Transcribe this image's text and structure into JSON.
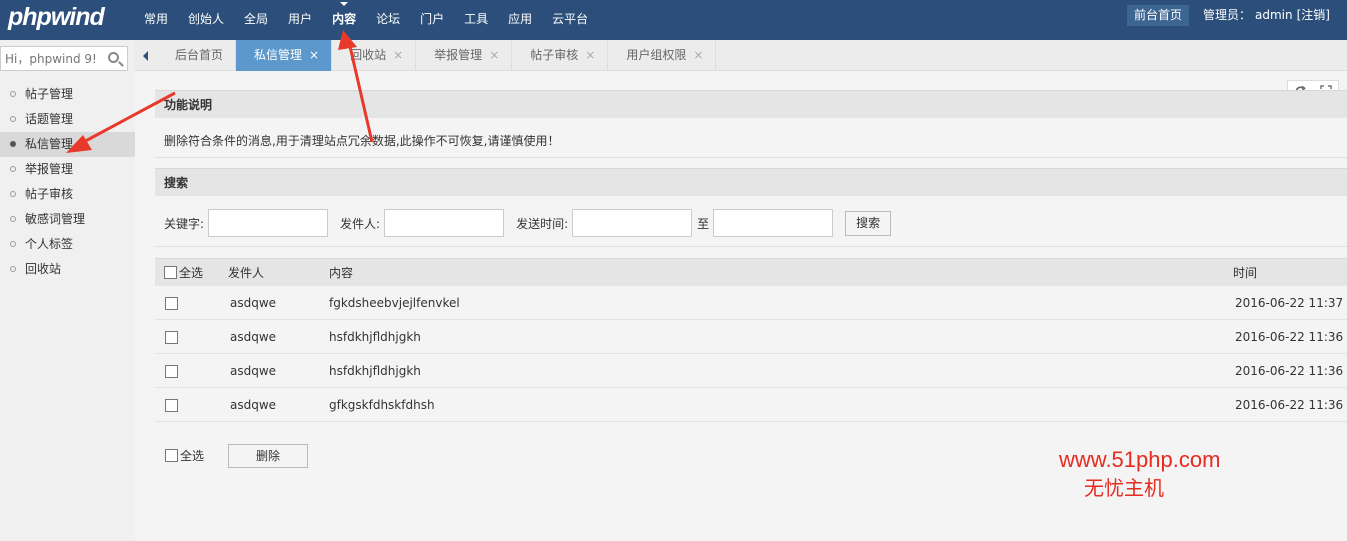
{
  "header": {
    "logo": "phpwind",
    "nav": [
      "常用",
      "创始人",
      "全局",
      "用户",
      "内容",
      "论坛",
      "门户",
      "工具",
      "应用",
      "云平台"
    ],
    "active_nav": "内容",
    "front_home": "前台首页",
    "admin_label": "管理员：",
    "admin_name": "admin",
    "logout": "[注销]"
  },
  "sidebar": {
    "search_placeholder": "Hi，phpwind 9!",
    "items": [
      "帖子管理",
      "话题管理",
      "私信管理",
      "举报管理",
      "帖子审核",
      "敏感词管理",
      "个人标签",
      "回收站"
    ],
    "active_index": 2
  },
  "tabs": {
    "items": [
      "后台首页",
      "私信管理",
      "回收站",
      "举报管理",
      "帖子审核",
      "用户组权限"
    ],
    "active_index": 1,
    "close_glyph": "×"
  },
  "main": {
    "intro_title": "功能说明",
    "intro_text": "删除符合条件的消息,用于清理站点冗余数据,此操作不可恢复,请谨慎使用！",
    "search_title": "搜索",
    "search": {
      "keyword_label": "关键字:",
      "sender_label": "发件人:",
      "time_label": "发送时间:",
      "to_label": "至",
      "button": "搜索"
    },
    "table": {
      "headers": {
        "select_all": "全选",
        "sender": "发件人",
        "content": "内容",
        "time": "时间"
      },
      "rows": [
        {
          "sender": "asdqwe",
          "content": "fgkdsheebvjejlfenvkel",
          "time": "2016-06-22 11:37"
        },
        {
          "sender": "asdqwe",
          "content": "hsfdkhjfldhjgkh",
          "time": "2016-06-22 11:36"
        },
        {
          "sender": "asdqwe",
          "content": "hsfdkhjfldhjgkh",
          "time": "2016-06-22 11:36"
        },
        {
          "sender": "asdqwe",
          "content": "gfkgskfdhskfdhsh",
          "time": "2016-06-22 11:36"
        }
      ]
    },
    "footer": {
      "select_all": "全选",
      "delete_button": "删除"
    }
  },
  "watermark": {
    "url": "www.51php.com",
    "name": "无忧主机"
  },
  "icons": {
    "refresh": "refresh-icon",
    "fullscreen": "fullscreen-icon",
    "search": "search-icon"
  },
  "colors": {
    "topbar": "#2b4f7a",
    "active_tab": "#5d98cc",
    "annotation_red": "#e8392b"
  }
}
